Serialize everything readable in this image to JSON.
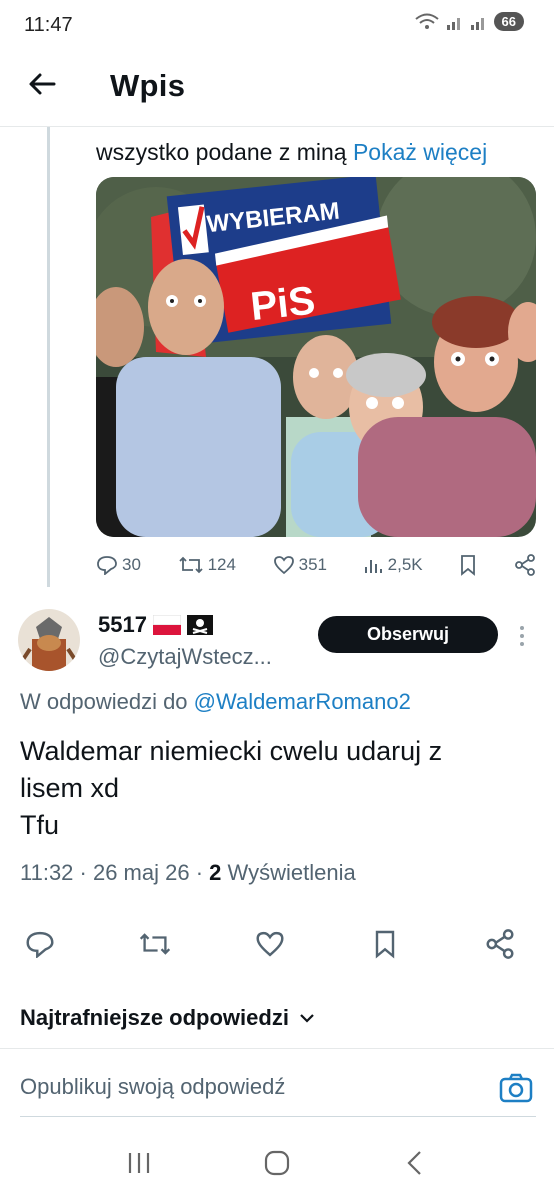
{
  "status": {
    "time": "11:47",
    "battery": "66"
  },
  "header": {
    "title": "Wpis"
  },
  "quoted": {
    "text": "wszystko podane z miną",
    "show_more": "Pokaż więcej",
    "sign_text": "WYBIERAM",
    "sign_party": "PiS",
    "stats": {
      "replies": "30",
      "reposts": "124",
      "likes": "351",
      "views": "2,5K"
    }
  },
  "reply": {
    "author_name": "5517",
    "author_handle": "@CzytajWstecz...",
    "follow_label": "Obserwuj",
    "reply_to_prefix": "W odpowiedzi do",
    "reply_to_handle": "@WaldemarRomano2",
    "text_line1": "Waldemar niemiecki cwelu udaruj z",
    "text_line2": "lisem xd",
    "text_line3": "Tfu",
    "meta_time": "11:32 · 26 maj 26 ·",
    "meta_views_count": "2",
    "meta_views_label": "Wyświetlenia"
  },
  "sort": {
    "label": "Najtrafniejsze odpowiedzi"
  },
  "compose": {
    "placeholder": "Opublikuj swoją odpowiedź"
  },
  "colors": {
    "link": "#1d7fc4",
    "text": "#0f1419",
    "muted": "#536471",
    "button": "#0f1419"
  }
}
